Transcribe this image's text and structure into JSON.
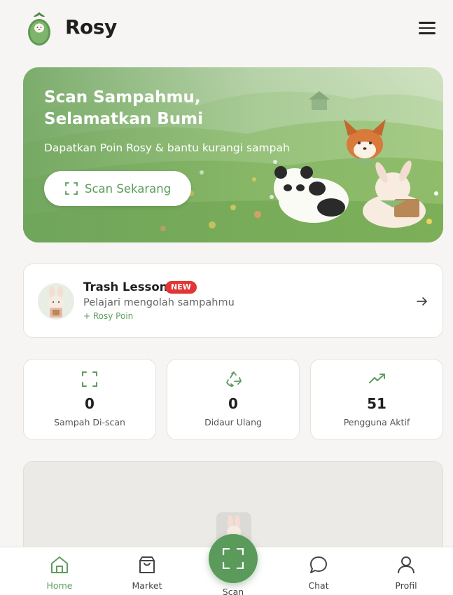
{
  "header": {
    "app_name": "Rosy",
    "logo_icon": "avocado-mascot-icon",
    "menu_icon": "hamburger-menu-icon"
  },
  "hero": {
    "title": "Scan Sampahmu, Selamatkan Bumi",
    "subtitle": "Dapatkan Poin Rosy & bantu kurangi sampah",
    "button_label": "Scan Sekarang",
    "button_icon": "scan-frame-icon"
  },
  "lesson": {
    "title": "Trash Lesson",
    "badge": "NEW",
    "description": "Pelajari mengolah sampahmu",
    "points": "+ Rosy Poin",
    "arrow_icon": "arrow-right-icon"
  },
  "stats": [
    {
      "icon": "scan-frame-icon",
      "value": "0",
      "label": "Sampah Di-scan"
    },
    {
      "icon": "recycle-icon",
      "value": "0",
      "label": "Didaur Ulang"
    },
    {
      "icon": "trending-up-icon",
      "value": "51",
      "label": "Pengguna Aktif"
    }
  ],
  "nav": {
    "items": [
      {
        "label": "Home",
        "icon": "home-icon",
        "active": true
      },
      {
        "label": "Market",
        "icon": "shopping-bag-icon",
        "active": false
      },
      {
        "label": "Scan",
        "icon": "scan-frame-icon",
        "active": false
      },
      {
        "label": "Chat",
        "icon": "chat-bubble-icon",
        "active": false
      },
      {
        "label": "Profil",
        "icon": "user-icon",
        "active": false
      }
    ]
  },
  "colors": {
    "accent": "#5e9c5e",
    "badge": "#e23535",
    "background": "#f7f5f3"
  }
}
